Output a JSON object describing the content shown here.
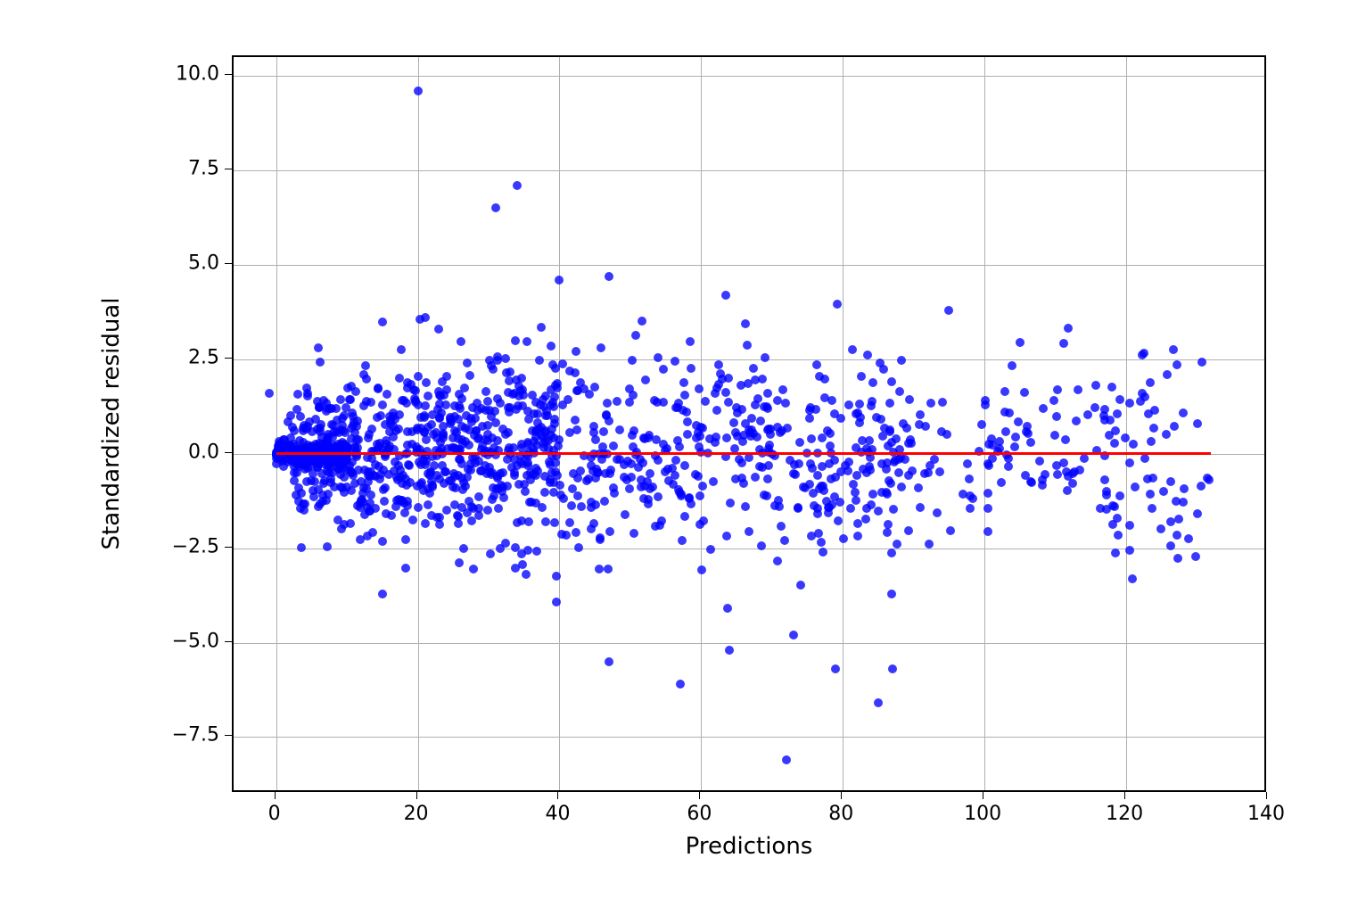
{
  "chart_data": {
    "type": "scatter",
    "xlabel": "Predictions",
    "ylabel": "Standardized residual",
    "xlim": [
      -6,
      140
    ],
    "ylim": [
      -9,
      10.5
    ],
    "xticks": [
      0,
      20,
      40,
      60,
      80,
      100,
      120,
      140
    ],
    "yticks": [
      -7.5,
      -5.0,
      -2.5,
      0.0,
      2.5,
      5.0,
      7.5,
      10.0
    ],
    "xtick_labels": [
      "0",
      "20",
      "40",
      "60",
      "80",
      "100",
      "120",
      "140"
    ],
    "ytick_labels": [
      "−7.5",
      "−5.0",
      "−2.5",
      "0.0",
      "2.5",
      "5.0",
      "7.5",
      "10.0"
    ],
    "hline": {
      "y": 0,
      "x0": 0,
      "x1": 132,
      "color": "#ff0000"
    },
    "grid": true,
    "scatter_color": "#0000ff",
    "n_points_approx": 2000,
    "random_seed": 123456,
    "dense_cluster": {
      "x0": 0,
      "x1": 10,
      "n_frac": 0.35
    },
    "spread_model": "heteroscedastic_funnel_from_origin",
    "outliers": [
      {
        "x": 20,
        "y": 9.6
      },
      {
        "x": 31,
        "y": 6.5
      },
      {
        "x": 34,
        "y": 7.1
      },
      {
        "x": 72,
        "y": -8.1
      },
      {
        "x": 85,
        "y": -6.6
      },
      {
        "x": 57,
        "y": -6.1
      },
      {
        "x": 47,
        "y": -5.5
      },
      {
        "x": 64,
        "y": -5.2
      },
      {
        "x": 73,
        "y": -4.8
      },
      {
        "x": 79,
        "y": -5.7
      },
      {
        "x": 87,
        "y": -5.7
      },
      {
        "x": 40,
        "y": 4.6
      },
      {
        "x": 47,
        "y": 4.7
      },
      {
        "x": 95,
        "y": 3.8
      },
      {
        "x": 21,
        "y": 3.6
      },
      {
        "x": 15,
        "y": 3.5
      },
      {
        "x": 23,
        "y": 3.3
      },
      {
        "x": -1,
        "y": 1.6
      }
    ]
  }
}
